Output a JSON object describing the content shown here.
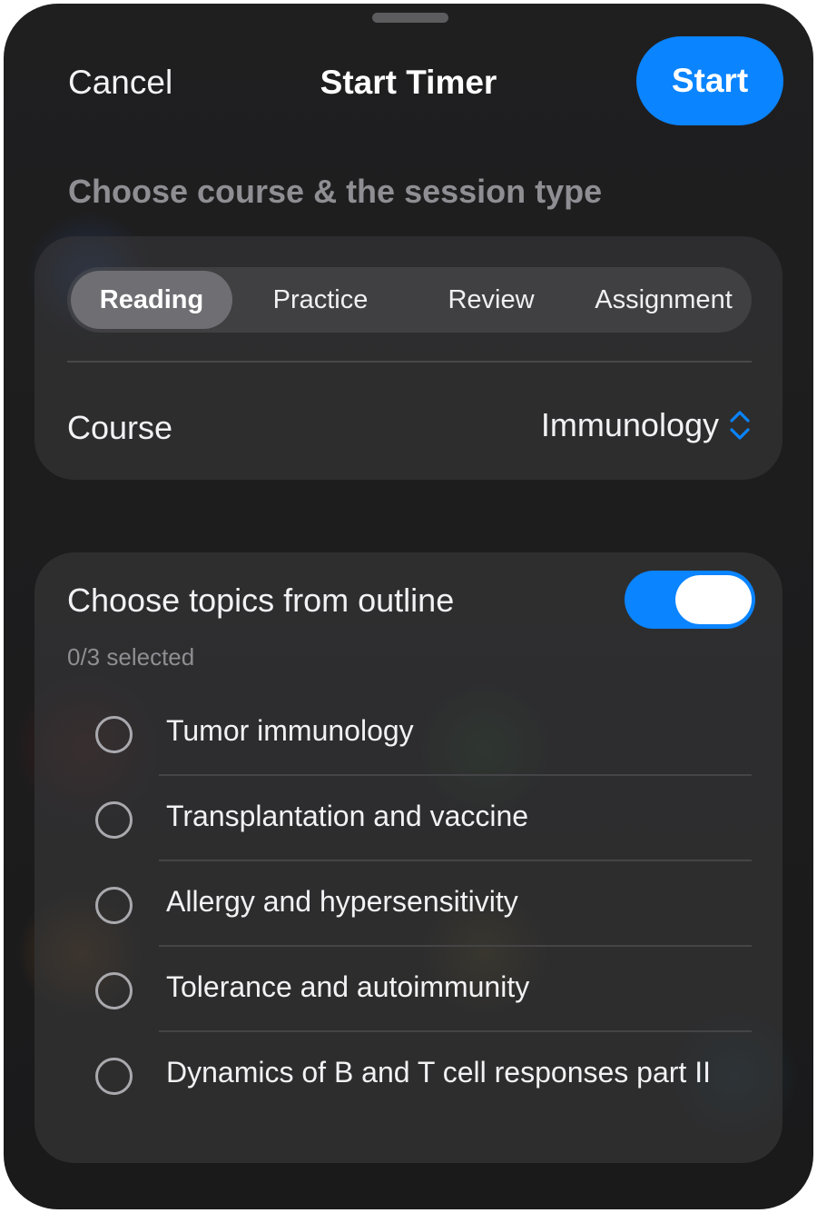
{
  "header": {
    "cancel_label": "Cancel",
    "title": "Start Timer",
    "start_label": "Start"
  },
  "subtitle": "Choose course & the session type",
  "session_types": {
    "items": [
      "Reading",
      "Practice",
      "Review",
      "Assignment"
    ],
    "selected": "Reading"
  },
  "course": {
    "label": "Course",
    "value": "Immunology",
    "picker_icon": "chevron-up-down-icon"
  },
  "topics": {
    "title": "Choose topics from outline",
    "toggle_on": true,
    "selected_count": "0/3 selected",
    "items": [
      "Tumor immunology",
      "Transplantation and vaccine",
      "Allergy and hypersensitivity",
      "Tolerance and autoimmunity",
      "Dynamics of B and T cell responses part II"
    ]
  },
  "colors": {
    "accent": "#0a84ff",
    "background": "#1c1c1e",
    "card": "#3a3a3c",
    "secondary_text": "#8e8e93"
  }
}
